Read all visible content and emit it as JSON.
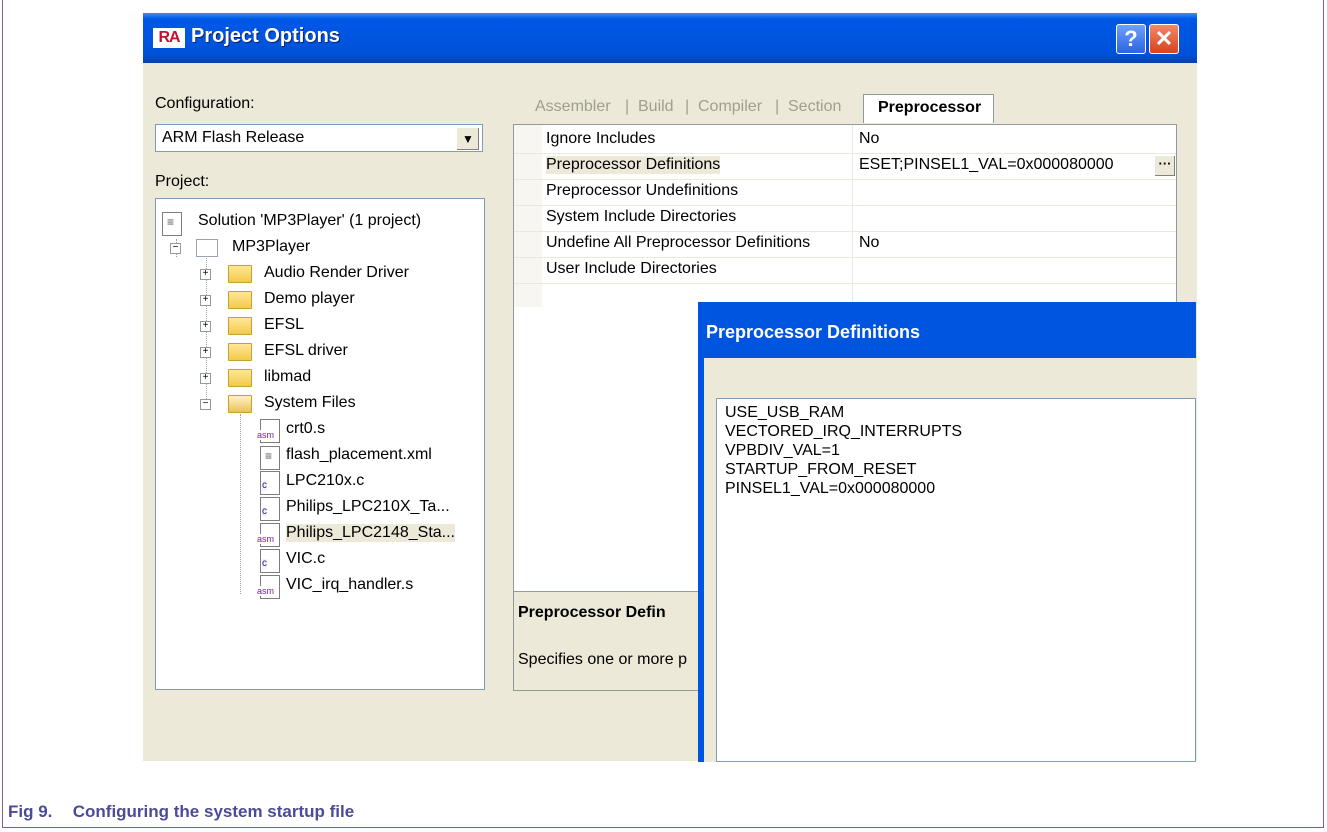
{
  "window": {
    "icon": "RA",
    "title": "Project Options",
    "help_icon": "?",
    "close_icon": "✕"
  },
  "left": {
    "configuration_label": "Configuration:",
    "configuration_value": "ARM Flash Release",
    "project_label": "Project:"
  },
  "tree": [
    {
      "label": "Solution 'MP3Player' (1 project)"
    },
    {
      "label": "MP3Player"
    },
    {
      "label": "Audio Render Driver"
    },
    {
      "label": "Demo player"
    },
    {
      "label": "EFSL"
    },
    {
      "label": "EFSL driver"
    },
    {
      "label": "libmad"
    },
    {
      "label": "System Files"
    },
    {
      "label": "crt0.s"
    },
    {
      "label": "flash_placement.xml"
    },
    {
      "label": "LPC210x.c"
    },
    {
      "label": "Philips_LPC210X_Ta..."
    },
    {
      "label": "Philips_LPC2148_Sta..."
    },
    {
      "label": "VIC.c"
    },
    {
      "label": "VIC_irq_handler.s"
    }
  ],
  "tabs": [
    "Assembler",
    "Build",
    "Compiler",
    "Section",
    "Preprocessor"
  ],
  "properties": [
    {
      "name": "Ignore Includes",
      "value": "No"
    },
    {
      "name": "Preprocessor Definitions",
      "value": "ESET;PINSEL1_VAL=0x000080000"
    },
    {
      "name": "Preprocessor Undefinitions",
      "value": ""
    },
    {
      "name": "System Include Directories",
      "value": ""
    },
    {
      "name": "Undefine All Preprocessor Definitions",
      "value": "No"
    },
    {
      "name": "User Include Directories",
      "value": ""
    }
  ],
  "ellipsis": "···",
  "description": {
    "title": "Preprocessor Defin",
    "text": "Specifies one or more p"
  },
  "popup": {
    "title": "Preprocessor Definitions",
    "lines": [
      "USE_USB_RAM",
      "VECTORED_IRQ_INTERRUPTS",
      "VPBDIV_VAL=1",
      "STARTUP_FROM_RESET",
      "PINSEL1_VAL=0x000080000"
    ]
  },
  "caption": {
    "number": "Fig 9.",
    "text": "Configuring the system startup file"
  }
}
